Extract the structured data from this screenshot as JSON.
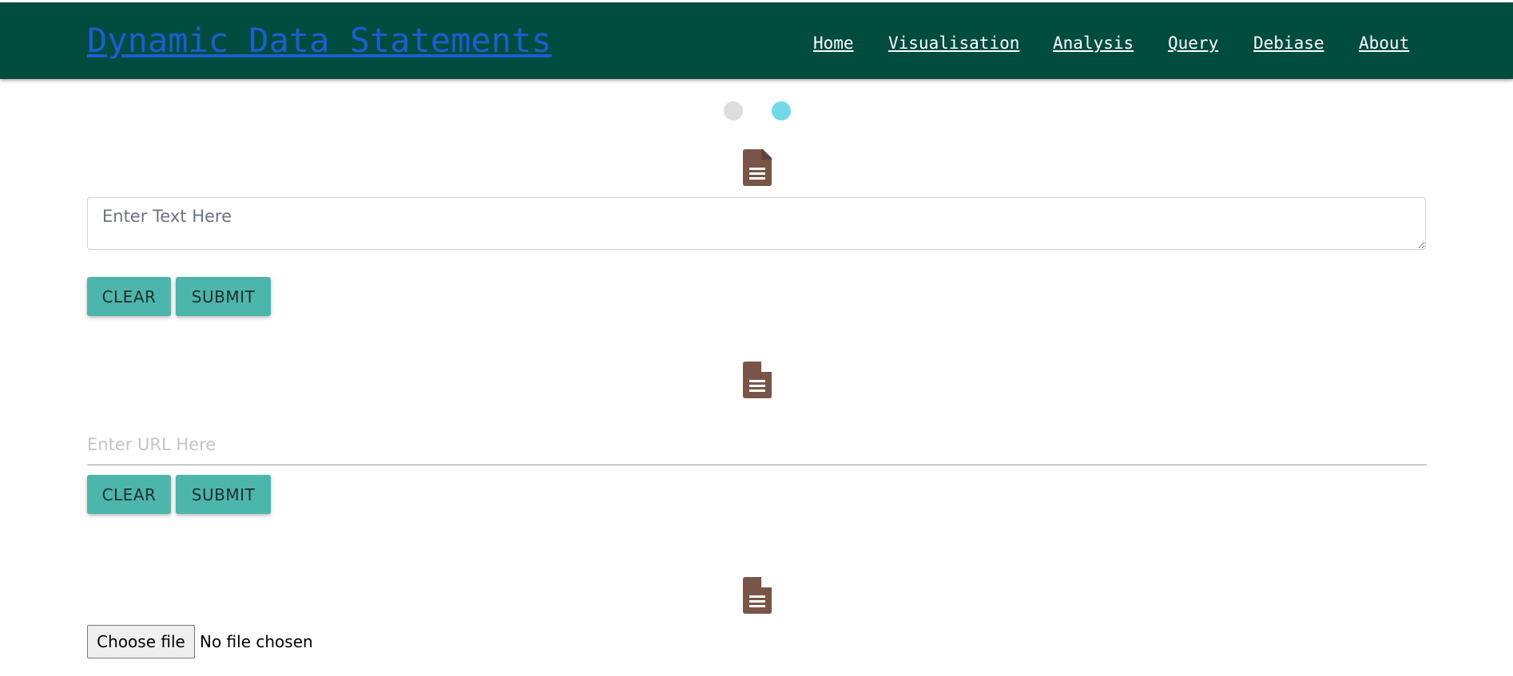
{
  "header": {
    "brand": "Dynamic Data Statements",
    "nav": [
      "Home",
      "Visualisation",
      "Analysis",
      "Query",
      "Debiase",
      "About"
    ]
  },
  "carousel": {
    "indicator_count": 2,
    "active_index": 1
  },
  "text_section": {
    "icon": "document-icon",
    "placeholder": "Enter Text Here",
    "clear_label": "CLEAR",
    "submit_label": "SUBMIT"
  },
  "url_section": {
    "icon": "document-icon",
    "placeholder": "Enter URL Here",
    "clear_label": "CLEAR",
    "submit_label": "SUBMIT"
  },
  "file_section": {
    "icon": "document-icon",
    "choose_label": "Choose file",
    "status": "No file chosen"
  },
  "colors": {
    "navbar": "#004d40",
    "brand_link": "#1a5fd1",
    "button": "#4db6ac",
    "icon": "#795548",
    "indicator_active": "#6fdaea",
    "indicator_inactive": "#dddddd"
  }
}
